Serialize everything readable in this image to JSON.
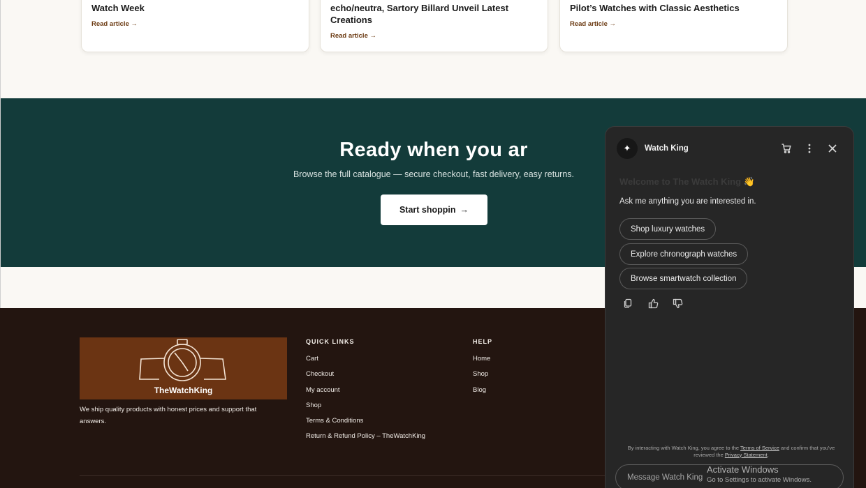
{
  "articles": [
    {
      "title": "Watch Week",
      "link": "Read article"
    },
    {
      "title": "echo/neutra, Sartory Billard Unveil Latest Creations",
      "link": "Read article"
    },
    {
      "title": "Pilot’s Watches with Classic Aesthetics",
      "link": "Read article"
    }
  ],
  "cta": {
    "title": "Ready when you ar",
    "subtitle": "Browse the full catalogue — secure checkout, fast delivery, easy returns.",
    "button": "Start shoppin",
    "button_icon": "→"
  },
  "footer": {
    "logo_text": "TheWatchKing",
    "tagline": "We ship quality products with honest prices and support that answers.",
    "quick_links": {
      "heading": "QUICK LINKS",
      "items": [
        "Cart",
        "Checkout",
        "My account",
        "Shop",
        "Terms & Conditions",
        "Return & Refund Policy – TheWatchKing"
      ]
    },
    "help": {
      "heading": "HELP",
      "items": [
        "Home",
        "Shop",
        "Blog"
      ]
    }
  },
  "chat": {
    "title": "Watch King",
    "avatar_icon": "sparkle-icon",
    "header_icons": [
      "cart-icon",
      "more-vertical-icon",
      "close-icon"
    ],
    "welcome": "Welcome to The Watch King",
    "welcome_emoji": "👋",
    "ask": "Ask me anything you are interested in.",
    "suggestions": [
      "Shop luxury watches",
      "Explore chronograph watches",
      "Browse smartwatch collection"
    ],
    "feedback_icons": [
      "copy-icon",
      "thumbs-up-icon",
      "thumbs-down-icon"
    ],
    "disclaimer_pre": "By interacting with Watch King, you agree to the ",
    "terms_link": "Terms of Service",
    "disclaimer_mid": " and confirm that you've reviewed the ",
    "privacy_link": "Privacy Statement",
    "disclaimer_post": ".",
    "input_placeholder": "Message Watch King"
  },
  "watermark": {
    "title": "Activate Windows",
    "subtitle": "Go to Settings to activate Windows."
  },
  "colors": {
    "cta_bg": "#133b3a",
    "footer_bg": "#231510",
    "logo_bg": "#6b3413",
    "link_brown": "#6b3a12",
    "chat_bg": "#262626"
  }
}
